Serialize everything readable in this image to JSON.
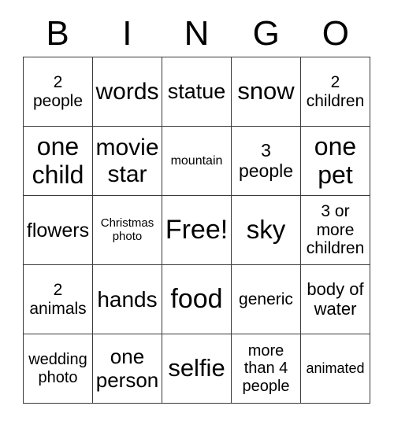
{
  "card": {
    "title": "BINGO",
    "header_letters": [
      "B",
      "I",
      "N",
      "G",
      "O"
    ],
    "columns": 5,
    "rows": 5,
    "colors": {
      "background": "#ffffff",
      "grid_line": "#3a3a3a",
      "text": "#000000"
    },
    "free_space": "Free!",
    "cells": [
      {
        "text": "2\npeople",
        "font_size": 21
      },
      {
        "text": "words",
        "font_size": 30
      },
      {
        "text": "statue",
        "font_size": 27
      },
      {
        "text": "snow",
        "font_size": 31
      },
      {
        "text": "2\nchildren",
        "font_size": 21
      },
      {
        "text": "one\nchild",
        "font_size": 32
      },
      {
        "text": "movie\nstar",
        "font_size": 30
      },
      {
        "text": "mountain",
        "font_size": 16
      },
      {
        "text": "3\npeople",
        "font_size": 23
      },
      {
        "text": "one\npet",
        "font_size": 32
      },
      {
        "text": "flowers",
        "font_size": 25
      },
      {
        "text": "Christmas\nphoto",
        "font_size": 15
      },
      {
        "text": "Free!",
        "font_size": 34
      },
      {
        "text": "sky",
        "font_size": 33
      },
      {
        "text": "3 or\nmore\nchildren",
        "font_size": 21
      },
      {
        "text": "2\nanimals",
        "font_size": 21
      },
      {
        "text": "hands",
        "font_size": 28
      },
      {
        "text": "food",
        "font_size": 34
      },
      {
        "text": "generic",
        "font_size": 21
      },
      {
        "text": "body of\nwater",
        "font_size": 22
      },
      {
        "text": "wedding\nphoto",
        "font_size": 20
      },
      {
        "text": "one\nperson",
        "font_size": 26
      },
      {
        "text": "selfie",
        "font_size": 31
      },
      {
        "text": "more\nthan 4\npeople",
        "font_size": 20
      },
      {
        "text": "animated",
        "font_size": 18
      }
    ]
  }
}
